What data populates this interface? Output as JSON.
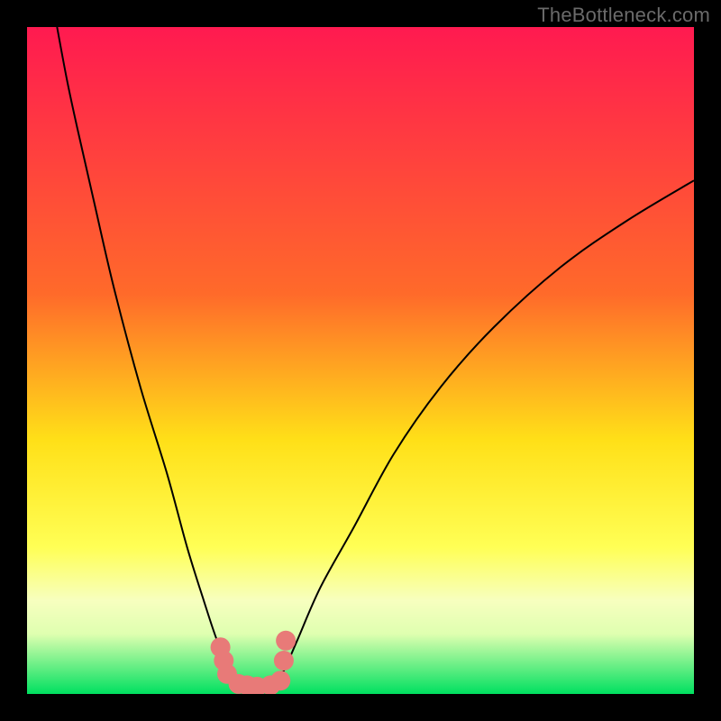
{
  "watermark": "TheBottleneck.com",
  "colors": {
    "gradient_top": "#ff1a50",
    "gradient_40": "#ff6a2a",
    "gradient_62": "#ffe018",
    "gradient_78": "#ffff55",
    "gradient_86": "#f7ffbf",
    "gradient_91": "#dfffb0",
    "gradient_bottom": "#00e060",
    "curve_stroke": "#000000",
    "marker_fill": "#e87a78",
    "frame": "#000000"
  },
  "chart_data": {
    "type": "line",
    "title": "",
    "xlabel": "",
    "ylabel": "",
    "xlim": [
      0,
      100
    ],
    "ylim": [
      0,
      100
    ],
    "series": [
      {
        "name": "bottleneck-curve",
        "points": [
          {
            "x": 4.5,
            "y": 100
          },
          {
            "x": 6,
            "y": 92
          },
          {
            "x": 7.5,
            "y": 85
          },
          {
            "x": 10,
            "y": 74
          },
          {
            "x": 13,
            "y": 61
          },
          {
            "x": 17,
            "y": 46
          },
          {
            "x": 21,
            "y": 33
          },
          {
            "x": 24,
            "y": 22
          },
          {
            "x": 26.5,
            "y": 14
          },
          {
            "x": 28.5,
            "y": 8
          },
          {
            "x": 30.5,
            "y": 3.5
          },
          {
            "x": 32,
            "y": 1.5
          },
          {
            "x": 33,
            "y": 1
          },
          {
            "x": 35,
            "y": 1
          },
          {
            "x": 37,
            "y": 1.5
          },
          {
            "x": 38.5,
            "y": 3.5
          },
          {
            "x": 40.5,
            "y": 8
          },
          {
            "x": 44,
            "y": 16
          },
          {
            "x": 49,
            "y": 25
          },
          {
            "x": 55,
            "y": 36
          },
          {
            "x": 62,
            "y": 46
          },
          {
            "x": 70,
            "y": 55
          },
          {
            "x": 80,
            "y": 64
          },
          {
            "x": 90,
            "y": 71
          },
          {
            "x": 100,
            "y": 77
          }
        ]
      },
      {
        "name": "highlight-markers",
        "points": [
          {
            "x": 29,
            "y": 7
          },
          {
            "x": 29.5,
            "y": 5
          },
          {
            "x": 30,
            "y": 3
          },
          {
            "x": 31.7,
            "y": 1.5
          },
          {
            "x": 33,
            "y": 1.3
          },
          {
            "x": 34.5,
            "y": 1.1
          },
          {
            "x": 36.5,
            "y": 1.3
          },
          {
            "x": 38,
            "y": 2
          },
          {
            "x": 38.5,
            "y": 5
          },
          {
            "x": 38.8,
            "y": 8
          }
        ]
      }
    ]
  }
}
